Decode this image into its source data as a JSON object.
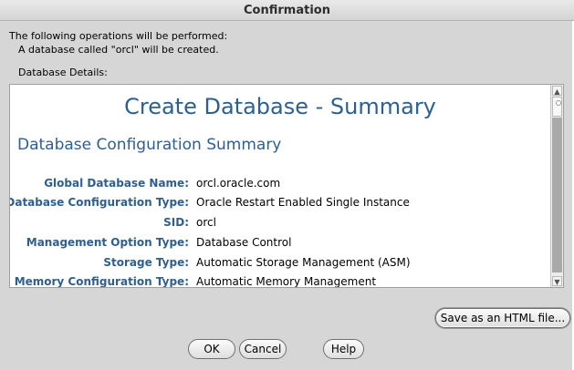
{
  "window": {
    "title": "Confirmation"
  },
  "intro": {
    "text": "The following operations will be performed:",
    "detail": "A database called \"orcl\" will be created."
  },
  "details_label": "Database Details:",
  "summary": {
    "title": "Create Database - Summary",
    "subtitle": "Database Configuration Summary",
    "rows": [
      {
        "label": "Global Database Name:",
        "value": "orcl.oracle.com"
      },
      {
        "label": "Database Configuration Type:",
        "value": "Oracle Restart Enabled Single Instance"
      },
      {
        "label": "SID:",
        "value": "orcl"
      },
      {
        "label": "Management Option Type:",
        "value": "Database Control"
      },
      {
        "label": "Storage Type:",
        "value": "Automatic Storage Management (ASM)"
      },
      {
        "label": "Memory Configuration Type:",
        "value": "Automatic Memory Management"
      }
    ]
  },
  "buttons": {
    "save_html": "Save as an HTML file...",
    "ok": "OK",
    "cancel": "Cancel",
    "help": "Help"
  }
}
